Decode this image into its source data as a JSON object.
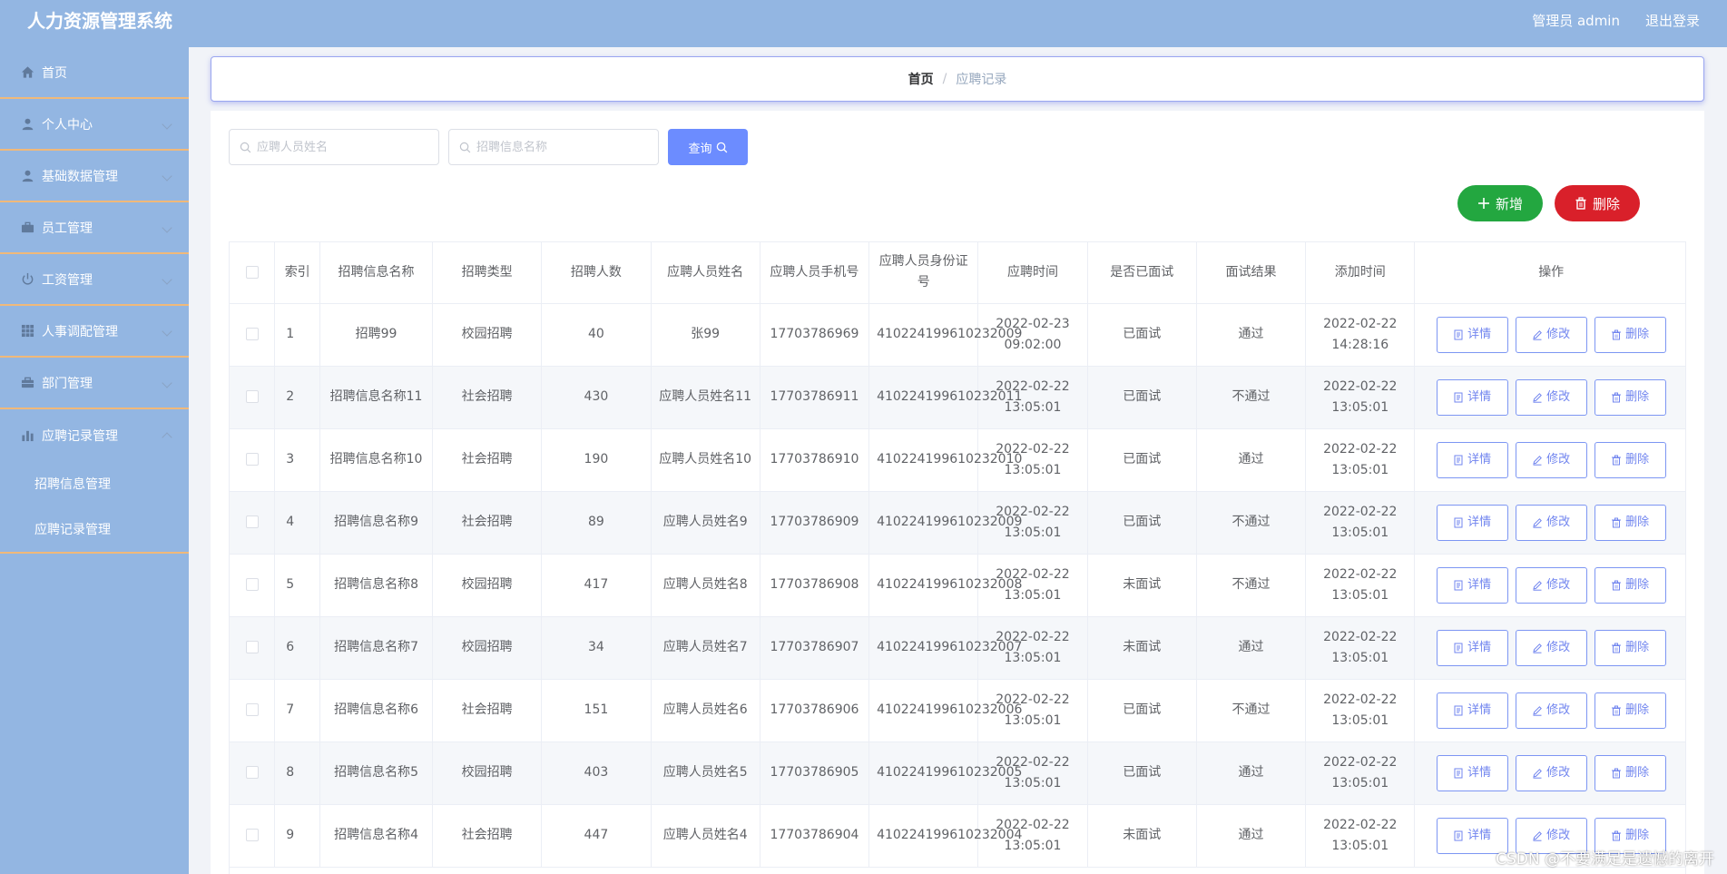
{
  "header": {
    "title": "人力资源管理系统",
    "user": "管理员 admin",
    "logout": "退出登录"
  },
  "sidebar": {
    "items": [
      {
        "label": "首页",
        "icon": "home-icon"
      },
      {
        "label": "个人中心",
        "icon": "user-icon"
      },
      {
        "label": "基础数据管理",
        "icon": "user-icon"
      },
      {
        "label": "员工管理",
        "icon": "briefcase-icon"
      },
      {
        "label": "工资管理",
        "icon": "power-icon"
      },
      {
        "label": "人事调配管理",
        "icon": "grid-icon"
      },
      {
        "label": "部门管理",
        "icon": "suitcase-icon"
      },
      {
        "label": "应聘记录管理",
        "icon": "bar-chart-icon"
      }
    ],
    "subitems": [
      {
        "label": "招聘信息管理"
      },
      {
        "label": "应聘记录管理"
      }
    ]
  },
  "breadcrumb": {
    "home": "首页",
    "separator": "/",
    "current": "应聘记录"
  },
  "search": {
    "name_placeholder": "应聘人员姓名",
    "info_placeholder": "招聘信息名称",
    "query_label": "查询"
  },
  "actions": {
    "add_label": "新增",
    "delete_label": "删除"
  },
  "table": {
    "columns": [
      "索引",
      "招聘信息名称",
      "招聘类型",
      "招聘人数",
      "应聘人员姓名",
      "应聘人员手机号",
      "应聘人员身份证号",
      "应聘时间",
      "是否已面试",
      "面试结果",
      "添加时间",
      "操作"
    ],
    "rows": [
      {
        "index": "1",
        "info": "招聘99",
        "type": "校园招聘",
        "count": "40",
        "name": "张99",
        "phone": "17703786969",
        "idcard": "410224199610232009",
        "apply_time": "2022-02-23 09:02:00",
        "interviewed": "已面试",
        "result": "通过",
        "add_time": "2022-02-22 14:28:16"
      },
      {
        "index": "2",
        "info": "招聘信息名称11",
        "type": "社会招聘",
        "count": "430",
        "name": "应聘人员姓名11",
        "phone": "17703786911",
        "idcard": "410224199610232011",
        "apply_time": "2022-02-22 13:05:01",
        "interviewed": "已面试",
        "result": "不通过",
        "add_time": "2022-02-22 13:05:01"
      },
      {
        "index": "3",
        "info": "招聘信息名称10",
        "type": "社会招聘",
        "count": "190",
        "name": "应聘人员姓名10",
        "phone": "17703786910",
        "idcard": "410224199610232010",
        "apply_time": "2022-02-22 13:05:01",
        "interviewed": "已面试",
        "result": "通过",
        "add_time": "2022-02-22 13:05:01"
      },
      {
        "index": "4",
        "info": "招聘信息名称9",
        "type": "社会招聘",
        "count": "89",
        "name": "应聘人员姓名9",
        "phone": "17703786909",
        "idcard": "410224199610232009",
        "apply_time": "2022-02-22 13:05:01",
        "interviewed": "已面试",
        "result": "不通过",
        "add_time": "2022-02-22 13:05:01"
      },
      {
        "index": "5",
        "info": "招聘信息名称8",
        "type": "校园招聘",
        "count": "417",
        "name": "应聘人员姓名8",
        "phone": "17703786908",
        "idcard": "410224199610232008",
        "apply_time": "2022-02-22 13:05:01",
        "interviewed": "未面试",
        "result": "不通过",
        "add_time": "2022-02-22 13:05:01"
      },
      {
        "index": "6",
        "info": "招聘信息名称7",
        "type": "校园招聘",
        "count": "34",
        "name": "应聘人员姓名7",
        "phone": "17703786907",
        "idcard": "410224199610232007",
        "apply_time": "2022-02-22 13:05:01",
        "interviewed": "未面试",
        "result": "通过",
        "add_time": "2022-02-22 13:05:01"
      },
      {
        "index": "7",
        "info": "招聘信息名称6",
        "type": "社会招聘",
        "count": "151",
        "name": "应聘人员姓名6",
        "phone": "17703786906",
        "idcard": "410224199610232006",
        "apply_time": "2022-02-22 13:05:01",
        "interviewed": "已面试",
        "result": "不通过",
        "add_time": "2022-02-22 13:05:01"
      },
      {
        "index": "8",
        "info": "招聘信息名称5",
        "type": "校园招聘",
        "count": "403",
        "name": "应聘人员姓名5",
        "phone": "17703786905",
        "idcard": "410224199610232005",
        "apply_time": "2022-02-22 13:05:01",
        "interviewed": "已面试",
        "result": "通过",
        "add_time": "2022-02-22 13:05:01"
      },
      {
        "index": "9",
        "info": "招聘信息名称4",
        "type": "社会招聘",
        "count": "447",
        "name": "应聘人员姓名4",
        "phone": "17703786904",
        "idcard": "410224199610232004",
        "apply_time": "2022-02-22 13:05:01",
        "interviewed": "未面试",
        "result": "通过",
        "add_time": "2022-02-22 13:05:01"
      }
    ],
    "row_actions": {
      "detail": "详情",
      "edit": "修改",
      "delete": "删除"
    }
  },
  "watermark": "CSDN @不要满足是遗憾的离开",
  "colors": {
    "theme": "#93b6e2",
    "menu_divider": "#f0b97a",
    "query_button": "#6c8cff",
    "add_button": "#23a740",
    "delete_button": "#d9202a",
    "row_button_border": "#7d96f3"
  }
}
